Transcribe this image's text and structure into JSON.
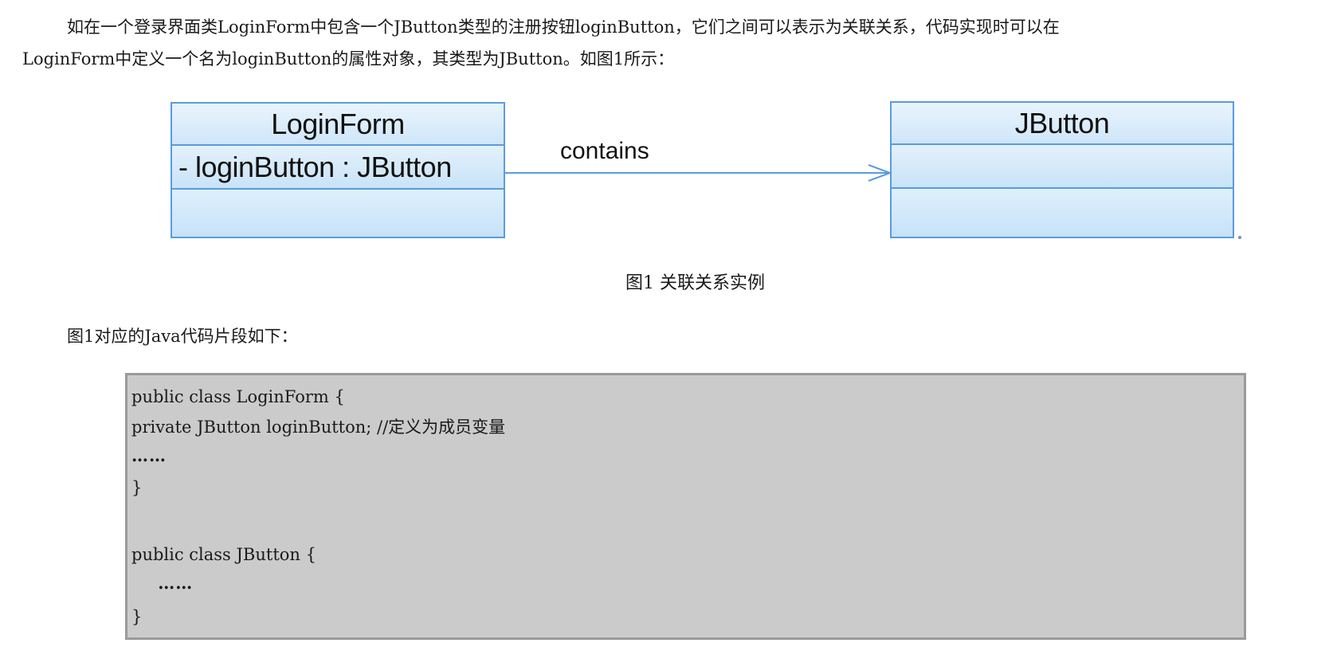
{
  "intro": {
    "line1": "如在一个登录界面类LoginForm中包含一个JButton类型的注册按钮loginButton，它们之间可以表示为关联关系，代码实现时可以在",
    "line2": "LoginForm中定义一个名为loginButton的属性对象，其类型为JButton。如图1所示："
  },
  "diagram": {
    "class_left": {
      "name": "LoginForm",
      "attribute": "- loginButton : JButton"
    },
    "class_right": {
      "name": "JButton",
      "attribute": ""
    },
    "association_label": "contains",
    "colors": {
      "border": "#5a9be0",
      "fill": "#d9ecfb"
    }
  },
  "caption": "图1 关联关系实例",
  "lead": "图1对应的Java代码片段如下：",
  "code": {
    "lines": [
      "public class LoginForm {",
      "private JButton loginButton; //定义为成员变量",
      "……",
      "}",
      "public class JButton {",
      "    ……",
      "}"
    ],
    "background": "#cbcbcb"
  }
}
